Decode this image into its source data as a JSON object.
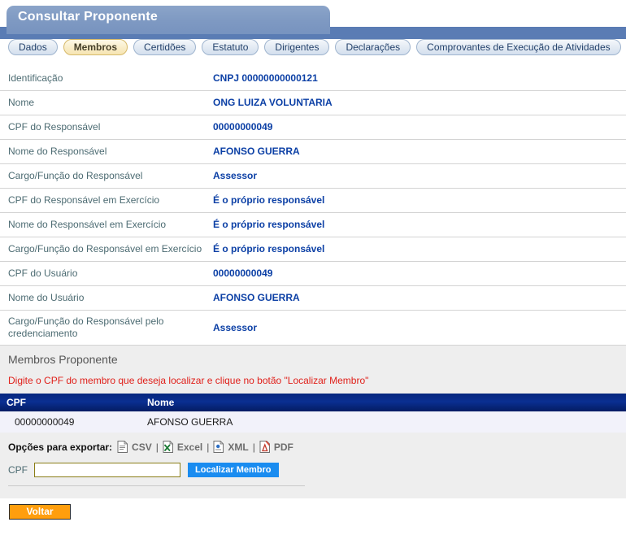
{
  "header": {
    "title": "Consultar Proponente"
  },
  "tabs": [
    {
      "label": "Dados",
      "active": false
    },
    {
      "label": "Membros",
      "active": true
    },
    {
      "label": "Certidões",
      "active": false
    },
    {
      "label": "Estatuto",
      "active": false
    },
    {
      "label": "Dirigentes",
      "active": false
    },
    {
      "label": "Declarações",
      "active": false
    },
    {
      "label": "Comprovantes de Execução de Atividades",
      "active": false
    }
  ],
  "details": [
    {
      "label": "Identificação",
      "value": "CNPJ 00000000000121"
    },
    {
      "label": "Nome",
      "value": "ONG LUIZA VOLUNTARIA"
    },
    {
      "label": "CPF do Responsável",
      "value": "00000000049"
    },
    {
      "label": "Nome do Responsável",
      "value": "AFONSO GUERRA"
    },
    {
      "label": "Cargo/Função do Responsável",
      "value": "Assessor"
    },
    {
      "label": "CPF do Responsável em Exercício",
      "value": "É o próprio responsável"
    },
    {
      "label": "Nome do Responsável em Exercício",
      "value": "É o próprio responsável"
    },
    {
      "label": "Cargo/Função do Responsável em Exercício",
      "value": "É o próprio responsável"
    },
    {
      "label": "CPF do Usuário",
      "value": "00000000049"
    },
    {
      "label": "Nome do Usuário",
      "value": "AFONSO GUERRA"
    },
    {
      "label": "Cargo/Função do Responsável pelo credenciamento",
      "value": "Assessor"
    }
  ],
  "section": {
    "title": "Membros Proponente",
    "warning": "Digite o CPF do membro que deseja localizar e clique no botão \"Localizar Membro\""
  },
  "table": {
    "columns": [
      "CPF",
      "Nome"
    ],
    "rows": [
      {
        "cpf": "00000000049",
        "nome": "AFONSO GUERRA"
      }
    ]
  },
  "export": {
    "label": "Opções para exportar:",
    "separator": "|",
    "options": [
      {
        "label": "CSV",
        "icon": "csv-file-icon"
      },
      {
        "label": "Excel",
        "icon": "excel-file-icon"
      },
      {
        "label": "XML",
        "icon": "xml-file-icon"
      },
      {
        "label": "PDF",
        "icon": "pdf-file-icon"
      }
    ]
  },
  "search": {
    "label": "CPF",
    "value": "",
    "placeholder": "",
    "button_label": "Localizar Membro"
  },
  "footer": {
    "back_label": "Voltar"
  },
  "colors": {
    "title_bar": "#7e99c2",
    "title_underbar": "#5a7cb4",
    "active_tab": "#f9edc8",
    "value_text": "#0b3fa5",
    "label_text": "#4c6b72",
    "warning_text": "#e0201a",
    "grid_header": "#0a2f92",
    "grid_row": "#f2f2fa",
    "panel_bg": "#eeeeee",
    "locate_button": "#1a8cf0",
    "back_button": "#ff9e0d",
    "input_border": "#8a7d16"
  }
}
